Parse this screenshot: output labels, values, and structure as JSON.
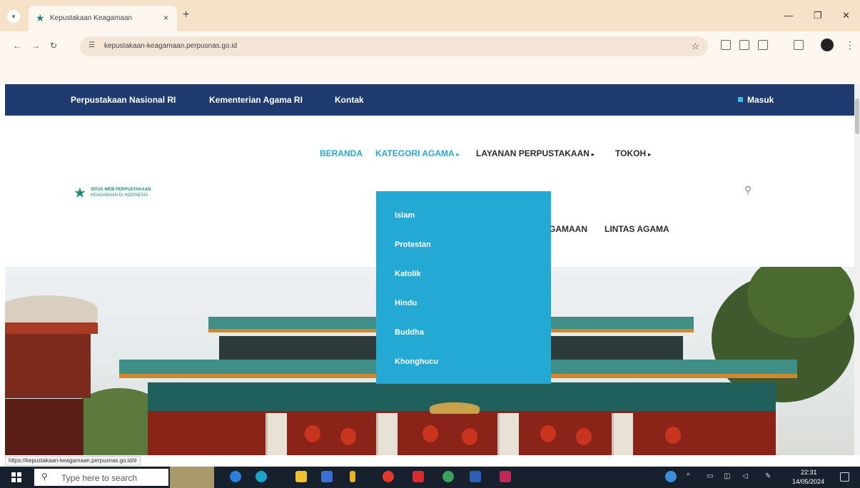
{
  "browser": {
    "tab_title": "Kepustakaan Keagamaan",
    "tab_close": "×",
    "new_tab": "+",
    "url": "kepustakaan-keagamaan.perpusnas.go.id",
    "status_url": "https://kepustakaan-keagamaan.perpusnas.go.id/#"
  },
  "topbar": {
    "links": [
      "Perpustakaan Nasional RI",
      "Kementerian Agama RI",
      "Kontak"
    ],
    "login": "Masuk"
  },
  "logo": {
    "line1": "SITUS WEB PERPUSTAKAAN",
    "line2": "KEAGAMAAN DI INDONESIA"
  },
  "main_nav": {
    "items": [
      {
        "label": "BERANDA"
      },
      {
        "label": "KATEGORI AGAMA"
      },
      {
        "label": "LAYANAN PERPUSTAKAAN"
      },
      {
        "label": "TOKOH"
      }
    ]
  },
  "sub_nav": {
    "items": [
      {
        "label": "GAMAAN"
      },
      {
        "label": "LINTAS AGAMA"
      }
    ]
  },
  "dropdown": {
    "items": [
      "Islam",
      "Protestan",
      "Katolik",
      "Hindu",
      "Buddha",
      "Khonghucu"
    ]
  },
  "taskbar": {
    "search_placeholder": "Type here to search",
    "time": "22:31",
    "date": "14/05/2024"
  },
  "colors": {
    "topbar": "#1e3a6e",
    "accent": "#2aa7d5",
    "dropdown": "#24a8d4",
    "brand": "#1c8a7a"
  }
}
